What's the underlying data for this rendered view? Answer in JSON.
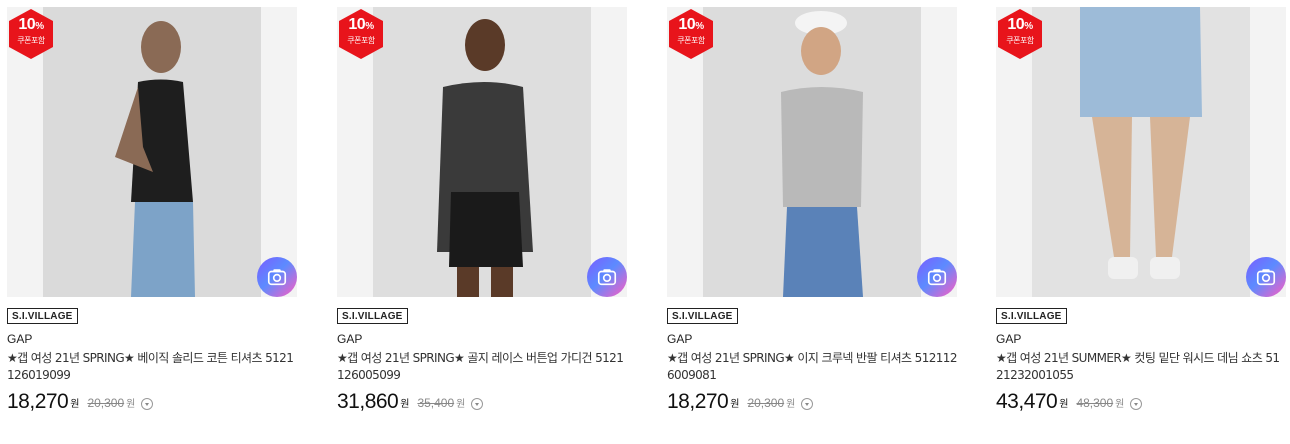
{
  "products": [
    {
      "badge": {
        "percent": "10",
        "unit": "%",
        "label": "쿠폰포함"
      },
      "photo_color": "#dadada",
      "mall": "S.I.VILLAGE",
      "brand": "GAP",
      "title": "★갭 여성 21년 SPRING★ 베이직 솔리드 코튼 티셔츠 5121126019099",
      "price": "18,270",
      "price_unit": "원",
      "original_price": "20,300",
      "original_unit": "원"
    },
    {
      "badge": {
        "percent": "10",
        "unit": "%",
        "label": "쿠폰포함"
      },
      "photo_color": "#dedede",
      "mall": "S.I.VILLAGE",
      "brand": "GAP",
      "title": "★갭 여성 21년 SPRING★ 골지 레이스 버튼업 가디건 5121126005099",
      "price": "31,860",
      "price_unit": "원",
      "original_price": "35,400",
      "original_unit": "원"
    },
    {
      "badge": {
        "percent": "10",
        "unit": "%",
        "label": "쿠폰포함"
      },
      "photo_color": "#dcdcdc",
      "mall": "S.I.VILLAGE",
      "brand": "GAP",
      "title": "★갭 여성 21년 SPRING★ 이지 크루넥 반팔 티셔츠 5121126009081",
      "price": "18,270",
      "price_unit": "원",
      "original_price": "20,300",
      "original_unit": "원"
    },
    {
      "badge": {
        "percent": "10",
        "unit": "%",
        "label": "쿠폰포함"
      },
      "photo_color": "#e2e2e2",
      "mall": "S.I.VILLAGE",
      "brand": "GAP",
      "title": "★갭 여성 21년 SUMMER★ 컷팅 밑단 워시드 데님 쇼츠 5121232001055",
      "price": "43,470",
      "price_unit": "원",
      "original_price": "48,300",
      "original_unit": "원"
    }
  ],
  "icons": {
    "camera": "camera-search-icon",
    "info": "chevron-down-circle-icon"
  },
  "colors": {
    "badge": "#e8141b",
    "camera_gradient": [
      "#7b5cff",
      "#5c8bff",
      "#ff5cc1"
    ]
  }
}
